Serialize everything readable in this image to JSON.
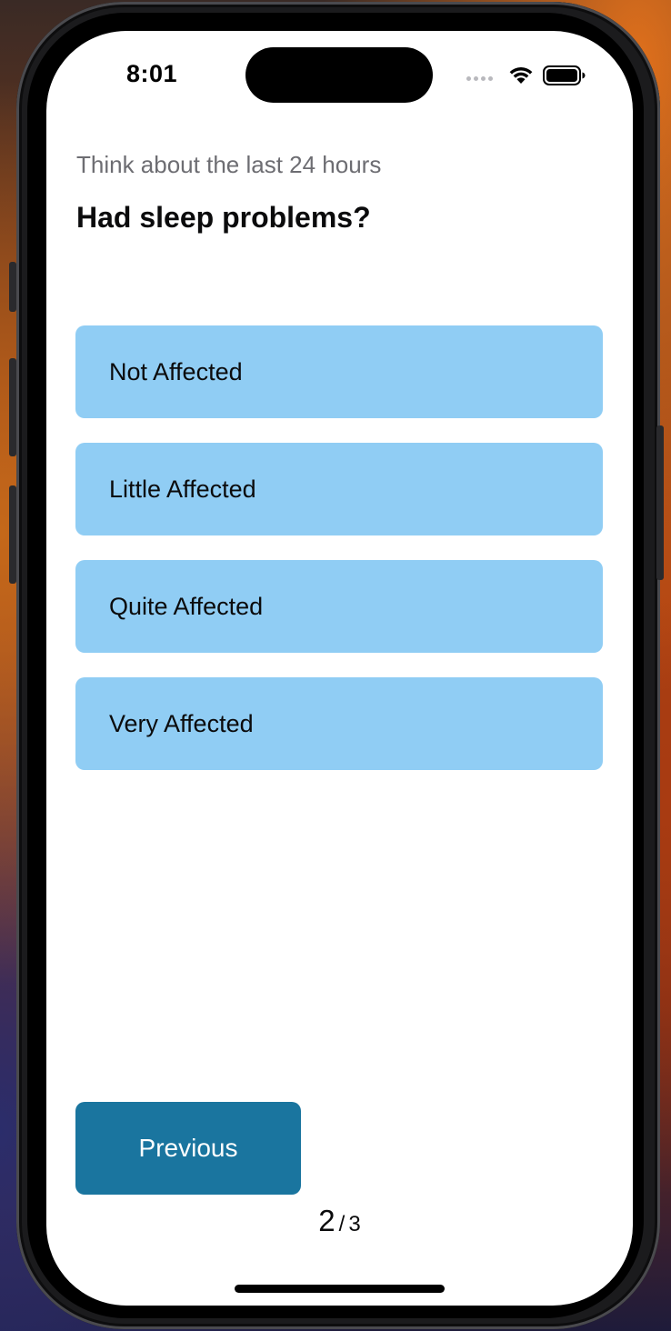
{
  "status_bar": {
    "time": "8:01"
  },
  "survey": {
    "subtitle": "Think about the last 24 hours",
    "question": "Had sleep problems?",
    "options": [
      {
        "label": "Not Affected"
      },
      {
        "label": "Little Affected"
      },
      {
        "label": "Quite Affected"
      },
      {
        "label": "Very Affected"
      }
    ],
    "previous_label": "Previous"
  },
  "pagination": {
    "current": "2",
    "separator": "/",
    "total": "3"
  },
  "colors": {
    "option_background": "#90cdf4",
    "primary_button": "#1a759f",
    "subtitle_text": "#6d6d72"
  },
  "icons": [
    "wifi-icon",
    "battery-icon",
    "cellular-signal-icon"
  ]
}
